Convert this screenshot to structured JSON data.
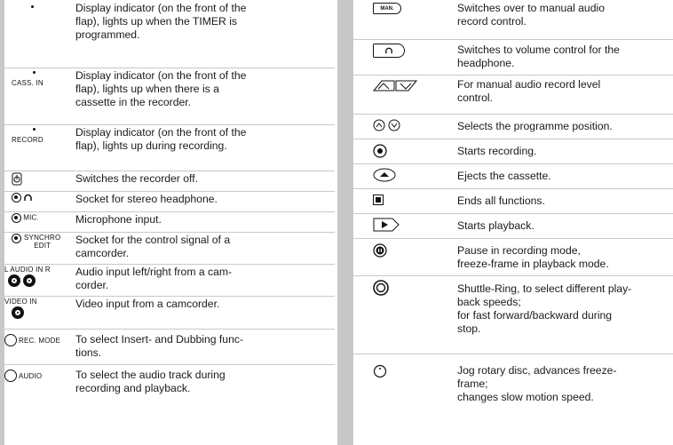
{
  "left_rows": [
    {
      "symbol_label": "",
      "description": "Display indicator (on the front of the\nflap), lights up when the TIMER is\nprogrammed."
    },
    {
      "symbol_label": "CASS. IN",
      "description": "Display indicator (on the front of the\nflap), lights up when there is a\ncassette in the recorder."
    },
    {
      "symbol_label": "RECORD",
      "description": "Display indicator (on the front of the\nflap), lights up during recording."
    },
    {
      "symbol_label": "",
      "description": "Switches the recorder off."
    },
    {
      "symbol_label": "",
      "description": "Socket for stereo headphone."
    },
    {
      "symbol_label": "MIC.",
      "description": "Microphone input."
    },
    {
      "symbol_label": "SYNCHRO\nEDIT",
      "description": "Socket for the control signal of a\ncamcorder."
    },
    {
      "symbol_label": "L AUDIO IN R",
      "description": "Audio input left/right from a cam-\ncorder."
    },
    {
      "symbol_label": "VIDEO IN",
      "description": "Video input from a camcorder."
    },
    {
      "symbol_label": "REC. MODE",
      "description": "To select Insert- and Dubbing func-\ntions."
    },
    {
      "symbol_label": "AUDIO",
      "description": "To select the audio track during\nrecording and playback."
    }
  ],
  "right_rows": [
    {
      "symbol_label": "MAN.",
      "description": "Switches over to manual audio\nrecord control."
    },
    {
      "symbol_label": "",
      "description": "Switches to volume control for the\nheadphone."
    },
    {
      "symbol_label": "",
      "description": "For manual audio record level\ncontrol."
    },
    {
      "symbol_label": "",
      "description": "Selects the programme position."
    },
    {
      "symbol_label": "",
      "description": "Starts recording."
    },
    {
      "symbol_label": "",
      "description": "Ejects the cassette."
    },
    {
      "symbol_label": "",
      "description": "Ends all functions."
    },
    {
      "symbol_label": "",
      "description": "Starts playback."
    },
    {
      "symbol_label": "",
      "description": "Pause in recording mode,\nfreeze-frame in playback mode."
    },
    {
      "symbol_label": "",
      "description": "Shuttle-Ring, to select different play-\nback speeds;\nfor fast forward/backward during\nstop."
    },
    {
      "symbol_label": "",
      "description": "Jog rotary disc, advances freeze-\nframe;\nchanges slow motion speed."
    }
  ]
}
